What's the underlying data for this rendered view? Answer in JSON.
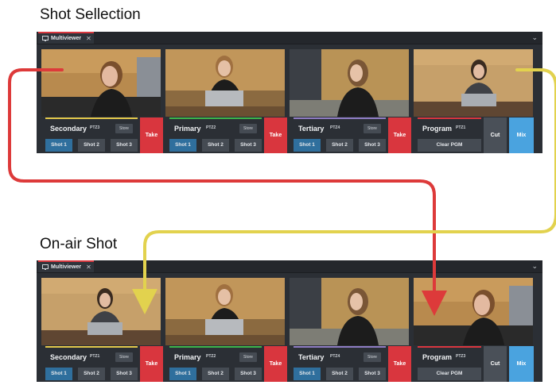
{
  "sections": [
    {
      "title": "Shot Sellection",
      "tab_label": "Multiviewer",
      "panels": [
        {
          "name": "Secondary",
          "tag": "PTZ3",
          "store": "Store",
          "shots": [
            "Shot 1",
            "Shot 2",
            "Shot 3"
          ],
          "take": "Take",
          "tally": "#e3c84b"
        },
        {
          "name": "Primary",
          "tag": "PTZ2",
          "store": "Store",
          "shots": [
            "Shot 1",
            "Shot 2",
            "Shot 3"
          ],
          "take": "Take",
          "tally": "#3cb44b"
        },
        {
          "name": "Tertiary",
          "tag": "PTZ4",
          "store": "Store",
          "shots": [
            "Shot 1",
            "Shot 2",
            "Shot 3"
          ],
          "take": "Take",
          "tally": "#8e7cc3"
        }
      ],
      "program": {
        "name": "Program",
        "tag": "PTZ1",
        "clear": "Clear PGM",
        "cut": "Cut",
        "mix": "Mix",
        "tally": "#d9363e"
      }
    },
    {
      "title": "On-air Shot",
      "tab_label": "Multiviewer",
      "panels": [
        {
          "name": "Secondary",
          "tag": "PTZ1",
          "store": "Store",
          "shots": [
            "Shot 1",
            "Shot 2",
            "Shot 3"
          ],
          "take": "Take",
          "tally": "#e3c84b"
        },
        {
          "name": "Primary",
          "tag": "PTZ2",
          "store": "Store",
          "shots": [
            "Shot 1",
            "Shot 2",
            "Shot 3"
          ],
          "take": "Take",
          "tally": "#3cb44b"
        },
        {
          "name": "Tertiary",
          "tag": "PTZ4",
          "store": "Store",
          "shots": [
            "Shot 1",
            "Shot 2",
            "Shot 3"
          ],
          "take": "Take",
          "tally": "#8e7cc3"
        }
      ],
      "program": {
        "name": "Program",
        "tag": "PTZ3",
        "clear": "Clear PGM",
        "cut": "Cut",
        "mix": "Mix",
        "tally": "#d9363e"
      }
    }
  ],
  "colors": {
    "take_red": "#d9363e",
    "mix_blue": "#4aa3df",
    "active_shot_blue": "#2f6f9d",
    "arrow_red": "#dd3a3a",
    "arrow_yellow": "#e2d24e"
  },
  "icons": {
    "tab_icon": "monitor-icon",
    "tab_close": "close-icon",
    "collapse": "chevron-down-icon"
  }
}
